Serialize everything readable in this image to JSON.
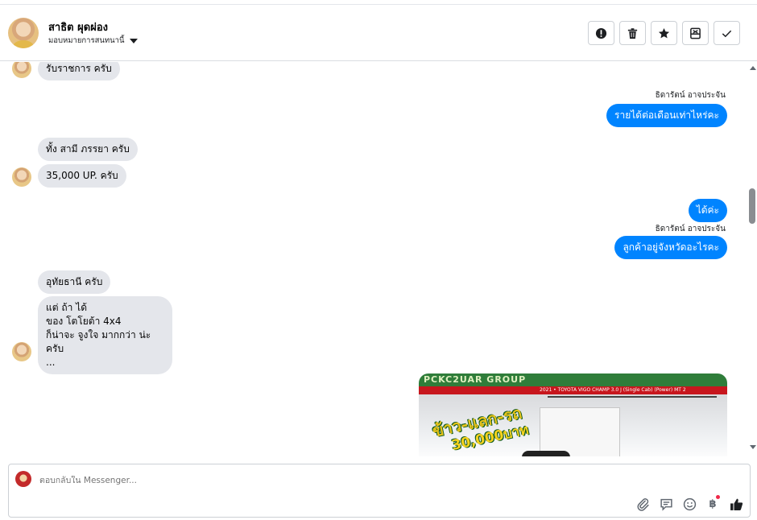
{
  "header": {
    "contact_name": "สาธิต ผุดผ่อง",
    "assign_label": "มอบหมายการสนทนานี้",
    "actions": [
      "report",
      "delete",
      "star",
      "archive",
      "done"
    ]
  },
  "messages": {
    "m1": "รับราชการ ครับ",
    "m2_sender": "ธิดารัตน์ อาจประจัน",
    "m2": "รายได้ต่อเดือนเท่าไหร่คะ",
    "m3": "ทั้ง สามี ภรรยา  ครับ",
    "m4": "35,000 UP. ครับ",
    "m5": "ได้ค่ะ",
    "m6_sender": "ธิดารัตน์ อาจประจัน",
    "m6": "ลูกค้าอยู่จังหวัดอะไรคะ",
    "m7": "อุทัยธานี  ครับ",
    "m8": "แต่  ถ้า ได้\nของ โตโยต้า 4x4\nก็น่าจะ จูงใจ มากกว่า น่ะครับ\n...",
    "image": {
      "banner_text": "PCKC2UAR GROUP",
      "strip_text": "2021 • TOYOTA VIGO CHAMP 3.0 J (Single Cab) (Power) MT 2",
      "promo_text": "ข้าว-แลก-รถ",
      "price_text": "30,000บาท"
    }
  },
  "composer": {
    "placeholder": "ตอบกลับใน Messenger...",
    "tools": [
      "attach-icon",
      "saved-reply-icon",
      "emoji-icon",
      "baht-icon",
      "like-icon"
    ],
    "baht_symbol": "฿"
  },
  "colors": {
    "outgoing": "#0084ff",
    "incoming": "#e4e6eb",
    "notification_dot": "#f02849"
  }
}
